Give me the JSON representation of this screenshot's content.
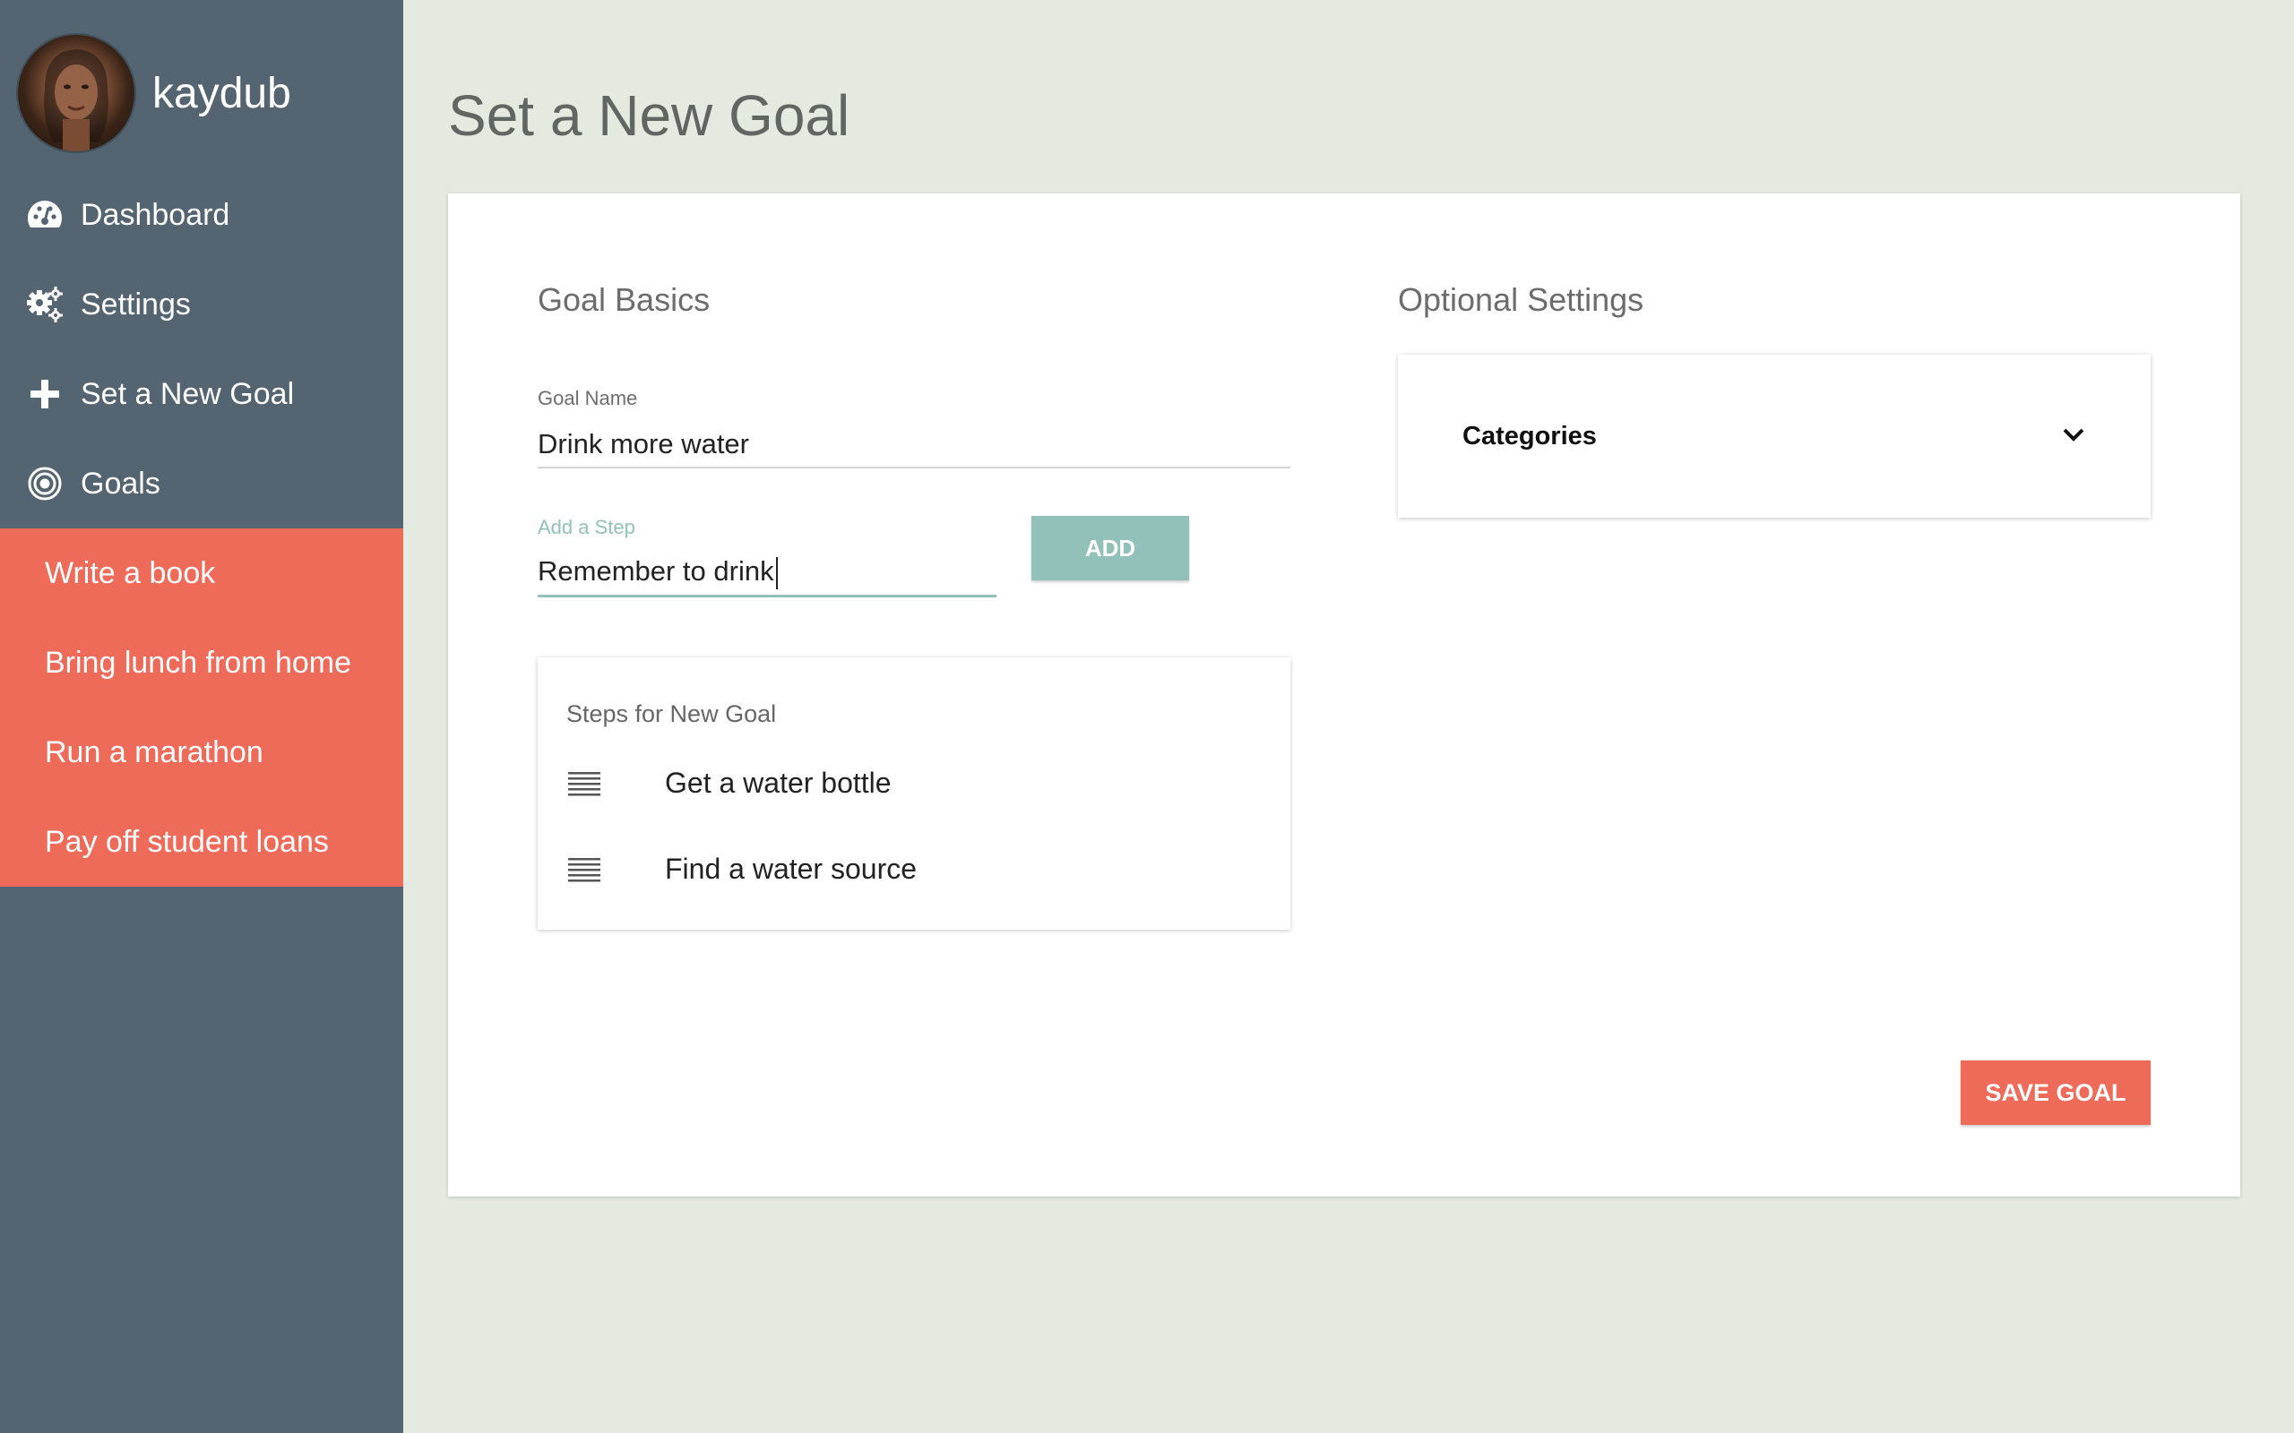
{
  "user": {
    "name": "kaydub"
  },
  "nav": [
    {
      "label": "Dashboard",
      "icon": "dashboard-icon"
    },
    {
      "label": "Settings",
      "icon": "gears-icon"
    },
    {
      "label": "Set a New Goal",
      "icon": "plus-icon"
    },
    {
      "label": "Goals",
      "icon": "target-icon"
    }
  ],
  "goals": [
    {
      "label": "Write a book"
    },
    {
      "label": "Bring lunch from home"
    },
    {
      "label": "Run a marathon"
    },
    {
      "label": "Pay off student loans"
    }
  ],
  "page": {
    "title": "Set a New Goal"
  },
  "form": {
    "basics_title": "Goal Basics",
    "goal_name_label": "Goal Name",
    "goal_name_value": "Drink more water",
    "step_label": "Add a Step",
    "step_value": "Remember to drink",
    "add_label": "ADD",
    "steps_title": "Steps for New Goal",
    "steps": [
      {
        "label": "Get a water bottle"
      },
      {
        "label": "Find a water source"
      }
    ],
    "optional_title": "Optional Settings",
    "categories_label": "Categories",
    "save_label": "SAVE GOAL"
  },
  "colors": {
    "sidebar": "#546571",
    "accent": "#ee6b5a",
    "teal": "#92c1b9",
    "background": "#e5eae1"
  }
}
